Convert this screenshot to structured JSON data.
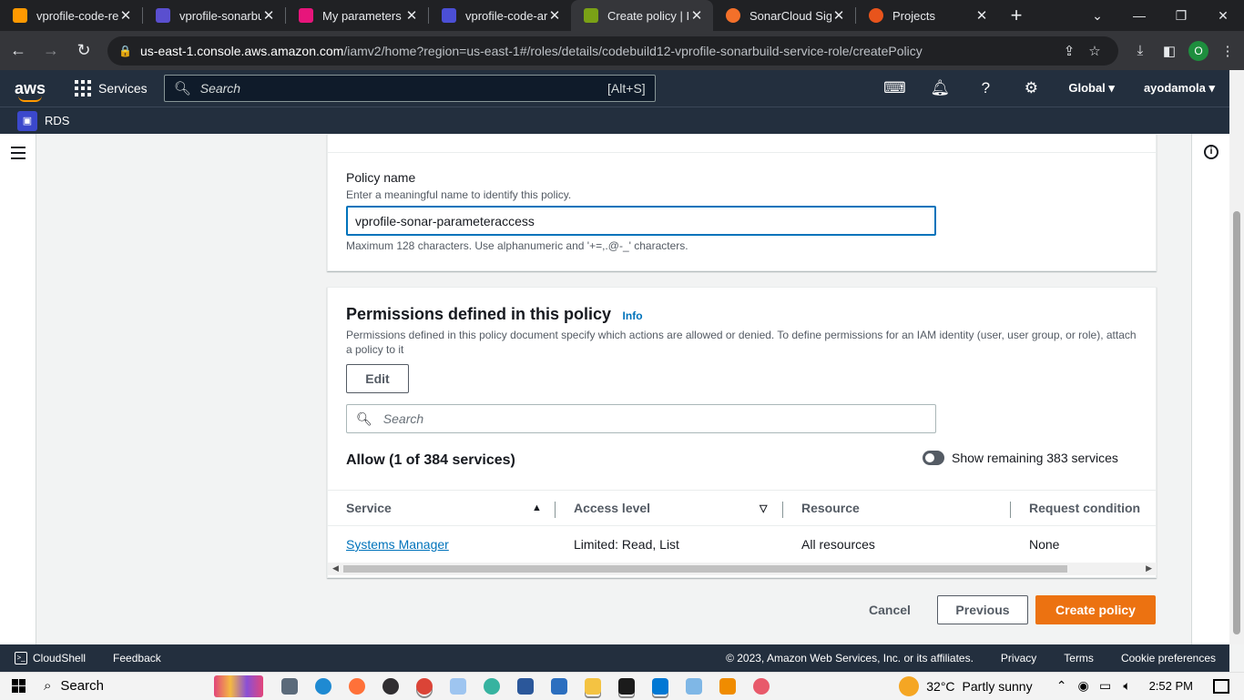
{
  "browser": {
    "tabs": [
      {
        "title": "vprofile-code-re",
        "favicon_color": "#ff9900",
        "active": false
      },
      {
        "title": "vprofile-sonarbu",
        "favicon_color": "#5a4fcf",
        "active": false
      },
      {
        "title": "My parameters -",
        "favicon_color": "#e7157b",
        "active": false
      },
      {
        "title": "vprofile-code-ar",
        "favicon_color": "#4b4fd6",
        "active": false
      },
      {
        "title": "Create policy | IA",
        "favicon_color": "#7aa116",
        "active": true
      },
      {
        "title": "SonarCloud Sign",
        "favicon_color": "#f3702a",
        "active": false
      },
      {
        "title": "Projects",
        "favicon_color": "#e8541c",
        "active": false
      }
    ],
    "url_host": "us-east-1.console.aws.amazon.com",
    "url_path": "/iamv2/home?region=us-east-1#/roles/details/codebuild12-vprofile-sonarbuild-service-role/createPolicy",
    "profile_initial": "O"
  },
  "aws_header": {
    "logo": "aws",
    "services_label": "Services",
    "search_placeholder": "Search",
    "search_shortcut": "[Alt+S]",
    "region": "Global",
    "user": "ayodamola",
    "favorite": "RDS"
  },
  "policy_name_section": {
    "label": "Policy name",
    "description": "Enter a meaningful name to identify this policy.",
    "value": "vprofile-sonar-parameteraccess",
    "constraint": "Maximum 128 characters. Use alphanumeric and '+=,.@-_' characters."
  },
  "permissions_section": {
    "title": "Permissions defined in this policy",
    "info_link": "Info",
    "description": "Permissions defined in this policy document specify which actions are allowed or denied. To define permissions for an IAM identity (user, user group, or role), attach a policy to it",
    "edit_label": "Edit",
    "search_placeholder": "Search",
    "allow_heading": "Allow (1 of 384 services)",
    "toggle_label": "Show remaining 383 services",
    "toggle_on": false,
    "table": {
      "columns": [
        "Service",
        "Access level",
        "Resource",
        "Request condition"
      ],
      "rows": [
        {
          "service": "Systems Manager",
          "access_level": "Limited: Read, List",
          "resource": "All resources",
          "request_condition": "None"
        }
      ]
    }
  },
  "actions": {
    "cancel": "Cancel",
    "previous": "Previous",
    "create": "Create policy"
  },
  "aws_footer": {
    "cloudshell": "CloudShell",
    "feedback": "Feedback",
    "copyright": "© 2023, Amazon Web Services, Inc. or its affiliates.",
    "privacy": "Privacy",
    "terms": "Terms",
    "cookies": "Cookie preferences"
  },
  "taskbar": {
    "search_label": "Search",
    "temperature": "32°C",
    "weather": "Partly sunny",
    "time": "2:52 PM"
  }
}
